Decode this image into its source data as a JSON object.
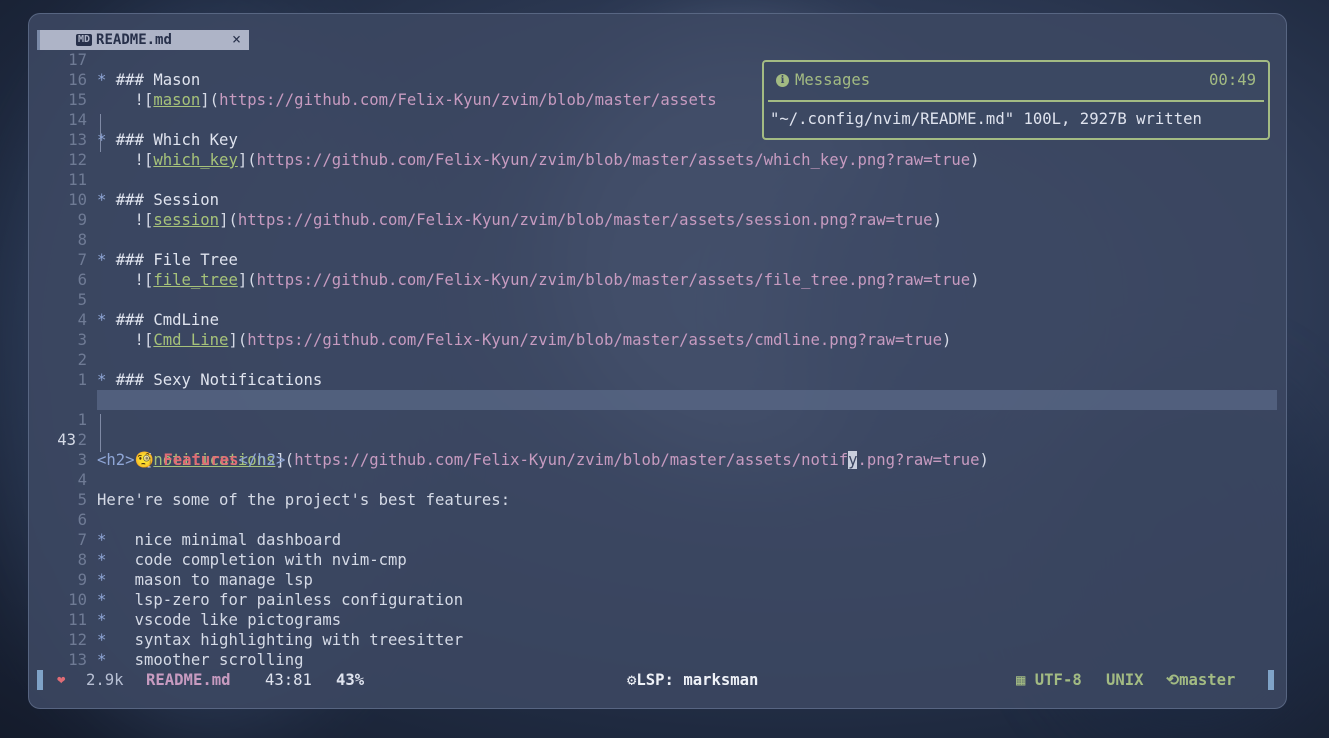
{
  "tab": {
    "icon": "MD",
    "title": "README.md",
    "close": "×"
  },
  "messages": {
    "title": "Messages",
    "time": "00:49",
    "body": "\"~/.config/nvim/README.md\" 100L, 2927B written"
  },
  "lines": {
    "l17": {
      "num": "17"
    },
    "l16": {
      "num": "16",
      "hdr": "### Mason"
    },
    "l15": {
      "num": "15",
      "label": "mason",
      "url": "https://github.com/Felix-Kyun/zvim/blob/master/assets"
    },
    "l14": {
      "num": "14"
    },
    "l13": {
      "num": "13",
      "hdr": "### Which Key"
    },
    "l12": {
      "num": "12",
      "label": "which_key",
      "url": "https://github.com/Felix-Kyun/zvim/blob/master/assets/which_key.png?raw=true"
    },
    "l11": {
      "num": "11"
    },
    "l10": {
      "num": "10",
      "hdr": "### Session"
    },
    "l9": {
      "num": "9",
      "label": "session",
      "url": "https://github.com/Felix-Kyun/zvim/blob/master/assets/session.png?raw=true"
    },
    "l8": {
      "num": "8"
    },
    "l7": {
      "num": "7",
      "hdr": "### File Tree"
    },
    "l6": {
      "num": "6",
      "label": "file_tree",
      "url": "https://github.com/Felix-Kyun/zvim/blob/master/assets/file_tree.png?raw=true"
    },
    "l5": {
      "num": "5"
    },
    "l4": {
      "num": "4",
      "hdr": "### CmdLine"
    },
    "l3": {
      "num": "3",
      "label": "Cmd Line",
      "url": "https://github.com/Felix-Kyun/zvim/blob/master/assets/cmdline.png?raw=true"
    },
    "l2": {
      "num": "2"
    },
    "l1": {
      "num": "1",
      "hdr": "### Sexy Notifications"
    },
    "cur": {
      "num": "43",
      "label": "notifications",
      "url_a": "https://github.com/Felix-Kyun/zvim/blob/master/assets/notif",
      "cursor": "y",
      "url_b": ".png?raw=true"
    },
    "a1": {
      "num": "1"
    },
    "a2": {
      "num": "2"
    },
    "a3": {
      "num": "3",
      "open": "<h2>",
      "emoji": "🧐",
      "text": "Features",
      "close": "</h2>"
    },
    "a4": {
      "num": "4"
    },
    "a5": {
      "num": "5",
      "text": "Here're some of the project's best features:"
    },
    "a6": {
      "num": "6"
    },
    "a7": {
      "num": "7",
      "text": "nice minimal dashboard"
    },
    "a8": {
      "num": "8",
      "text": "code completion with nvim-cmp"
    },
    "a9": {
      "num": "9",
      "text": "mason to manage lsp"
    },
    "a10": {
      "num": "10",
      "text": "lsp-zero for painless configuration"
    },
    "a11": {
      "num": "11",
      "text": "vscode like pictograms"
    },
    "a12": {
      "num": "12",
      "text": "syntax highlighting with treesitter"
    },
    "a13": {
      "num": "13",
      "text": "smoother scrolling"
    }
  },
  "status": {
    "size": "2.9k",
    "file": "README.md",
    "pos": "43:81",
    "pct": "43%",
    "lsp": "LSP: marksman",
    "encoding": "UTF-8",
    "format": "UNIX",
    "branch": "master"
  },
  "colors": {
    "accent": "#a3bb83",
    "link": "#a6c27a",
    "url": "#c79bc0",
    "error": "#e06c75"
  }
}
